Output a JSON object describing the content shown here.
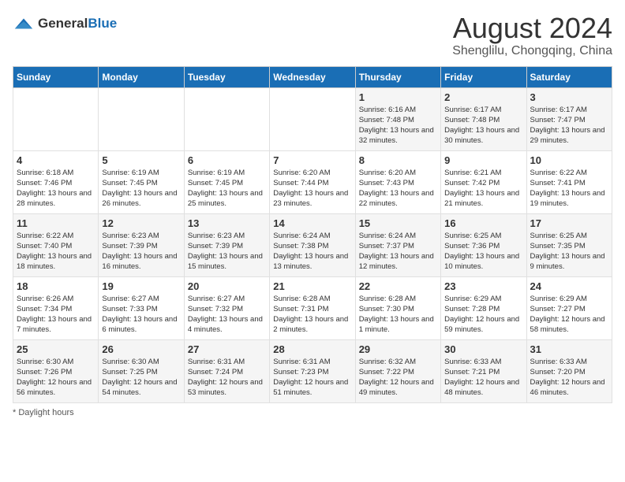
{
  "header": {
    "logo_general": "General",
    "logo_blue": "Blue",
    "main_title": "August 2024",
    "subtitle": "Shenglilu, Chongqing, China"
  },
  "days_of_week": [
    "Sunday",
    "Monday",
    "Tuesday",
    "Wednesday",
    "Thursday",
    "Friday",
    "Saturday"
  ],
  "footer": {
    "label": "Daylight hours"
  },
  "weeks": [
    [
      {
        "day": "",
        "sunrise": "",
        "sunset": "",
        "daylight": ""
      },
      {
        "day": "",
        "sunrise": "",
        "sunset": "",
        "daylight": ""
      },
      {
        "day": "",
        "sunrise": "",
        "sunset": "",
        "daylight": ""
      },
      {
        "day": "",
        "sunrise": "",
        "sunset": "",
        "daylight": ""
      },
      {
        "day": "1",
        "sunrise": "Sunrise: 6:16 AM",
        "sunset": "Sunset: 7:48 PM",
        "daylight": "Daylight: 13 hours and 32 minutes."
      },
      {
        "day": "2",
        "sunrise": "Sunrise: 6:17 AM",
        "sunset": "Sunset: 7:48 PM",
        "daylight": "Daylight: 13 hours and 30 minutes."
      },
      {
        "day": "3",
        "sunrise": "Sunrise: 6:17 AM",
        "sunset": "Sunset: 7:47 PM",
        "daylight": "Daylight: 13 hours and 29 minutes."
      }
    ],
    [
      {
        "day": "4",
        "sunrise": "Sunrise: 6:18 AM",
        "sunset": "Sunset: 7:46 PM",
        "daylight": "Daylight: 13 hours and 28 minutes."
      },
      {
        "day": "5",
        "sunrise": "Sunrise: 6:19 AM",
        "sunset": "Sunset: 7:45 PM",
        "daylight": "Daylight: 13 hours and 26 minutes."
      },
      {
        "day": "6",
        "sunrise": "Sunrise: 6:19 AM",
        "sunset": "Sunset: 7:45 PM",
        "daylight": "Daylight: 13 hours and 25 minutes."
      },
      {
        "day": "7",
        "sunrise": "Sunrise: 6:20 AM",
        "sunset": "Sunset: 7:44 PM",
        "daylight": "Daylight: 13 hours and 23 minutes."
      },
      {
        "day": "8",
        "sunrise": "Sunrise: 6:20 AM",
        "sunset": "Sunset: 7:43 PM",
        "daylight": "Daylight: 13 hours and 22 minutes."
      },
      {
        "day": "9",
        "sunrise": "Sunrise: 6:21 AM",
        "sunset": "Sunset: 7:42 PM",
        "daylight": "Daylight: 13 hours and 21 minutes."
      },
      {
        "day": "10",
        "sunrise": "Sunrise: 6:22 AM",
        "sunset": "Sunset: 7:41 PM",
        "daylight": "Daylight: 13 hours and 19 minutes."
      }
    ],
    [
      {
        "day": "11",
        "sunrise": "Sunrise: 6:22 AM",
        "sunset": "Sunset: 7:40 PM",
        "daylight": "Daylight: 13 hours and 18 minutes."
      },
      {
        "day": "12",
        "sunrise": "Sunrise: 6:23 AM",
        "sunset": "Sunset: 7:39 PM",
        "daylight": "Daylight: 13 hours and 16 minutes."
      },
      {
        "day": "13",
        "sunrise": "Sunrise: 6:23 AM",
        "sunset": "Sunset: 7:39 PM",
        "daylight": "Daylight: 13 hours and 15 minutes."
      },
      {
        "day": "14",
        "sunrise": "Sunrise: 6:24 AM",
        "sunset": "Sunset: 7:38 PM",
        "daylight": "Daylight: 13 hours and 13 minutes."
      },
      {
        "day": "15",
        "sunrise": "Sunrise: 6:24 AM",
        "sunset": "Sunset: 7:37 PM",
        "daylight": "Daylight: 13 hours and 12 minutes."
      },
      {
        "day": "16",
        "sunrise": "Sunrise: 6:25 AM",
        "sunset": "Sunset: 7:36 PM",
        "daylight": "Daylight: 13 hours and 10 minutes."
      },
      {
        "day": "17",
        "sunrise": "Sunrise: 6:25 AM",
        "sunset": "Sunset: 7:35 PM",
        "daylight": "Daylight: 13 hours and 9 minutes."
      }
    ],
    [
      {
        "day": "18",
        "sunrise": "Sunrise: 6:26 AM",
        "sunset": "Sunset: 7:34 PM",
        "daylight": "Daylight: 13 hours and 7 minutes."
      },
      {
        "day": "19",
        "sunrise": "Sunrise: 6:27 AM",
        "sunset": "Sunset: 7:33 PM",
        "daylight": "Daylight: 13 hours and 6 minutes."
      },
      {
        "day": "20",
        "sunrise": "Sunrise: 6:27 AM",
        "sunset": "Sunset: 7:32 PM",
        "daylight": "Daylight: 13 hours and 4 minutes."
      },
      {
        "day": "21",
        "sunrise": "Sunrise: 6:28 AM",
        "sunset": "Sunset: 7:31 PM",
        "daylight": "Daylight: 13 hours and 2 minutes."
      },
      {
        "day": "22",
        "sunrise": "Sunrise: 6:28 AM",
        "sunset": "Sunset: 7:30 PM",
        "daylight": "Daylight: 13 hours and 1 minute."
      },
      {
        "day": "23",
        "sunrise": "Sunrise: 6:29 AM",
        "sunset": "Sunset: 7:28 PM",
        "daylight": "Daylight: 12 hours and 59 minutes."
      },
      {
        "day": "24",
        "sunrise": "Sunrise: 6:29 AM",
        "sunset": "Sunset: 7:27 PM",
        "daylight": "Daylight: 12 hours and 58 minutes."
      }
    ],
    [
      {
        "day": "25",
        "sunrise": "Sunrise: 6:30 AM",
        "sunset": "Sunset: 7:26 PM",
        "daylight": "Daylight: 12 hours and 56 minutes."
      },
      {
        "day": "26",
        "sunrise": "Sunrise: 6:30 AM",
        "sunset": "Sunset: 7:25 PM",
        "daylight": "Daylight: 12 hours and 54 minutes."
      },
      {
        "day": "27",
        "sunrise": "Sunrise: 6:31 AM",
        "sunset": "Sunset: 7:24 PM",
        "daylight": "Daylight: 12 hours and 53 minutes."
      },
      {
        "day": "28",
        "sunrise": "Sunrise: 6:31 AM",
        "sunset": "Sunset: 7:23 PM",
        "daylight": "Daylight: 12 hours and 51 minutes."
      },
      {
        "day": "29",
        "sunrise": "Sunrise: 6:32 AM",
        "sunset": "Sunset: 7:22 PM",
        "daylight": "Daylight: 12 hours and 49 minutes."
      },
      {
        "day": "30",
        "sunrise": "Sunrise: 6:33 AM",
        "sunset": "Sunset: 7:21 PM",
        "daylight": "Daylight: 12 hours and 48 minutes."
      },
      {
        "day": "31",
        "sunrise": "Sunrise: 6:33 AM",
        "sunset": "Sunset: 7:20 PM",
        "daylight": "Daylight: 12 hours and 46 minutes."
      }
    ]
  ]
}
